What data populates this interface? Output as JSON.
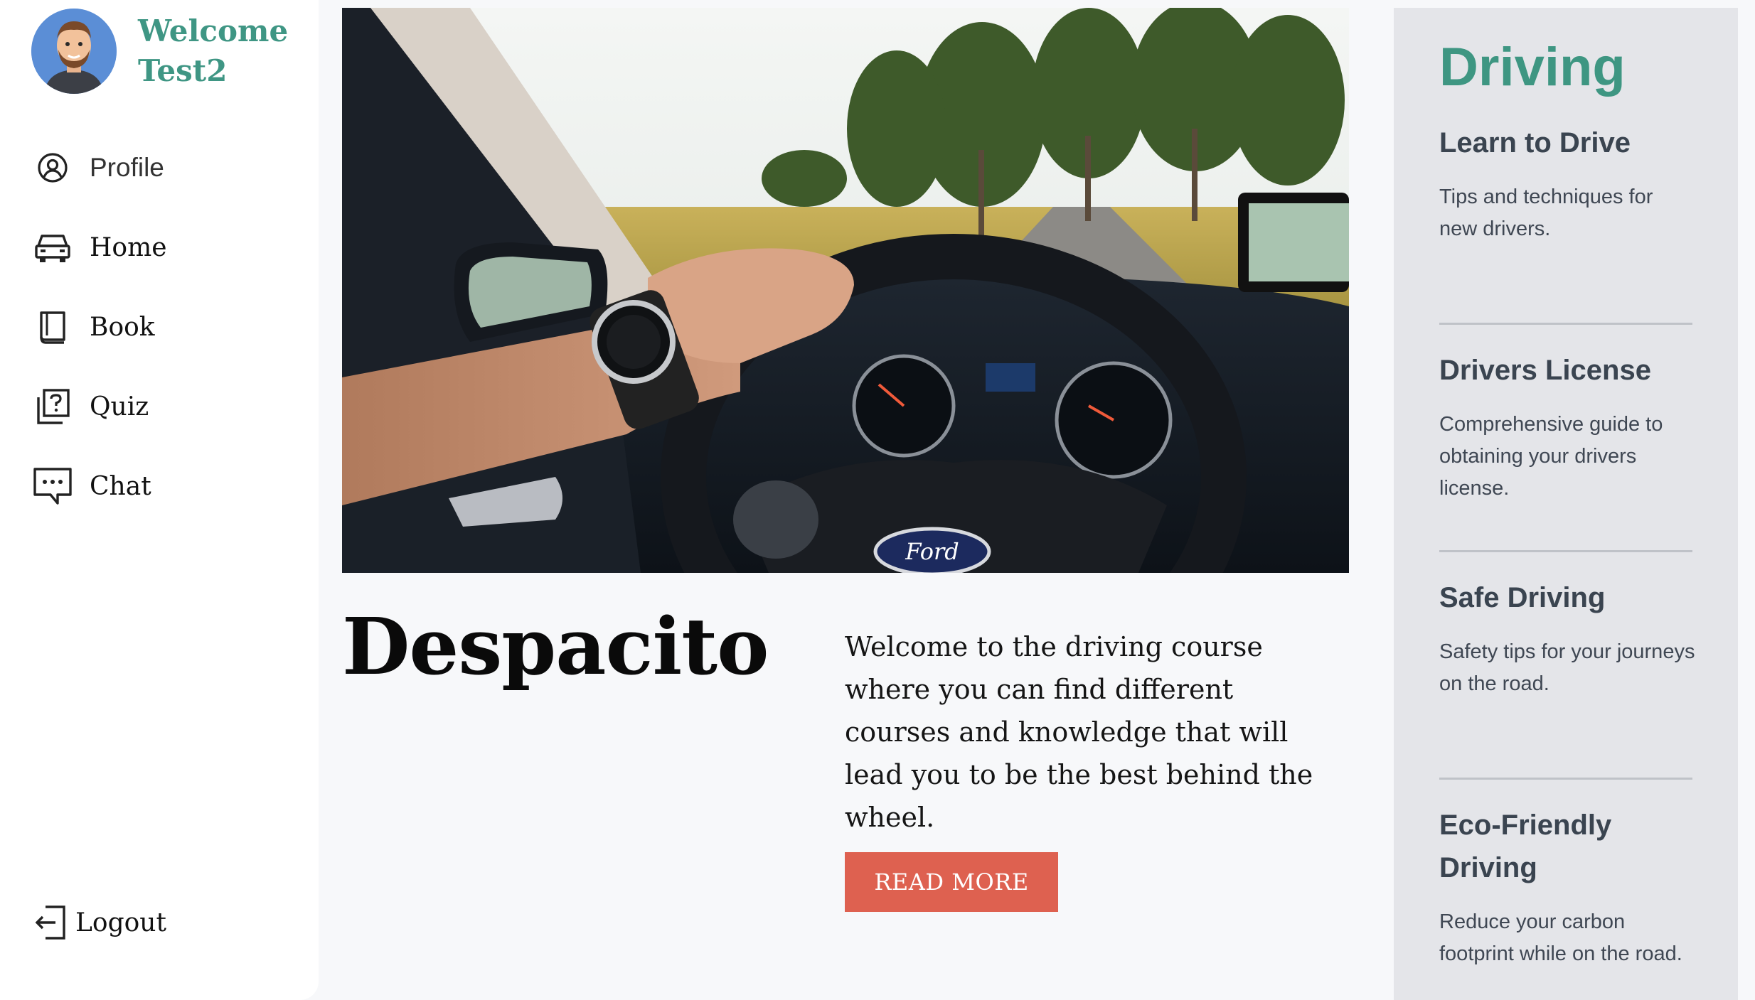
{
  "user": {
    "welcome_line1": "Welcome",
    "welcome_line2": "Test2"
  },
  "sidebar": {
    "items": [
      {
        "label": "Profile",
        "icon": "user-circle-icon"
      },
      {
        "label": "Home",
        "icon": "car-icon"
      },
      {
        "label": "Book",
        "icon": "book-icon"
      },
      {
        "label": "Quiz",
        "icon": "quiz-icon"
      },
      {
        "label": "Chat",
        "icon": "chat-icon"
      }
    ],
    "logout_label": "Logout"
  },
  "main": {
    "headline": "Despacito",
    "intro": "Welcome to the driving course where you can find different courses and knowledge that will lead you to be the best behind the wheel.",
    "read_more_label": "READ MORE",
    "hero_brand_badge": "Ford"
  },
  "right_panel": {
    "title": "Driving",
    "topics": [
      {
        "title": "Learn to Drive",
        "description": "Tips and techniques for new drivers."
      },
      {
        "title": "Drivers License",
        "description": "Comprehensive guide to obtaining your drivers license."
      },
      {
        "title": "Safe Driving",
        "description": "Safety tips for your journeys on the road."
      },
      {
        "title": "Eco-Friendly Driving",
        "description": "Reduce your carbon footprint while on the road."
      }
    ]
  },
  "colors": {
    "accent_green": "#3f9684",
    "button_red": "#de6150",
    "panel_gray": "#e4e5e9",
    "avatar_blue": "#5b8ed6"
  }
}
